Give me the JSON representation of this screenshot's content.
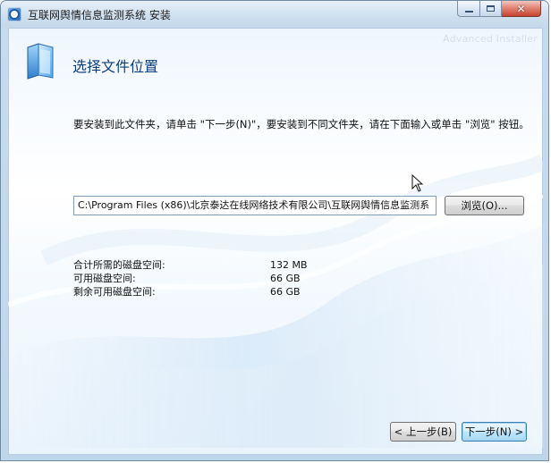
{
  "window": {
    "title": "互联网舆情信息监测系统 安装",
    "controls": {
      "minimize": "",
      "maximize": "",
      "close": "✕"
    }
  },
  "branding": {
    "watermark": "Advanced Installer"
  },
  "page": {
    "title": "选择文件位置",
    "instruction": "要安装到此文件夹，请单击 \"下一步(N)\"，要安装到不同文件夹，请在下面输入或单击 \"浏览\" 按钮。"
  },
  "path": {
    "value": "C:\\Program Files (x86)\\北京泰达在线网络技术有限公司\\互联网舆情信息监测系"
  },
  "browse_button": {
    "label": "浏览(O)..."
  },
  "disk_info": [
    {
      "label": "合计所需的磁盘空间:",
      "value": "132 MB"
    },
    {
      "label": "可用磁盘空间:",
      "value": "66 GB"
    },
    {
      "label": "剩余可用磁盘空间:",
      "value": "66 GB"
    }
  ],
  "navigation": {
    "back_label": "< 上一步(B)",
    "next_label": "下一步(N) >"
  },
  "icons": {
    "app": "installer-app-icon",
    "header": "folder-icon",
    "cursor": "mouse-pointer-icon"
  },
  "colors": {
    "title_text": "#0c3e7c",
    "window_frame": "#c6dbee",
    "close_button": "#c7412d"
  }
}
